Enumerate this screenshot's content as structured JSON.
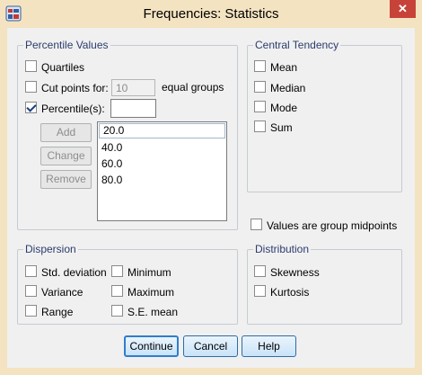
{
  "window": {
    "title": "Frequencies: Statistics",
    "close_glyph": "✕"
  },
  "percentile_values": {
    "title": "Percentile Values",
    "quartiles": {
      "label": "Quartiles",
      "checked": false
    },
    "cut_points": {
      "label": "Cut points for:",
      "value": "10",
      "suffix": "equal groups",
      "checked": false
    },
    "percentiles": {
      "label": "Percentile(s):",
      "value": "",
      "checked": true
    },
    "buttons": {
      "add": "Add",
      "change": "Change",
      "remove": "Remove"
    },
    "list": [
      "20.0",
      "40.0",
      "60.0",
      "80.0"
    ]
  },
  "central_tendency": {
    "title": "Central Tendency",
    "items": [
      "Mean",
      "Median",
      "Mode",
      "Sum"
    ]
  },
  "group_midpoints": {
    "label": "Values are group midpoints",
    "checked": false
  },
  "dispersion": {
    "title": "Dispersion",
    "items": [
      "Std. deviation",
      "Minimum",
      "Variance",
      "Maximum",
      "Range",
      "S.E. mean"
    ]
  },
  "distribution": {
    "title": "Distribution",
    "items": [
      "Skewness",
      "Kurtosis"
    ]
  },
  "footer": {
    "continue": "Continue",
    "cancel": "Cancel",
    "help": "Help"
  }
}
